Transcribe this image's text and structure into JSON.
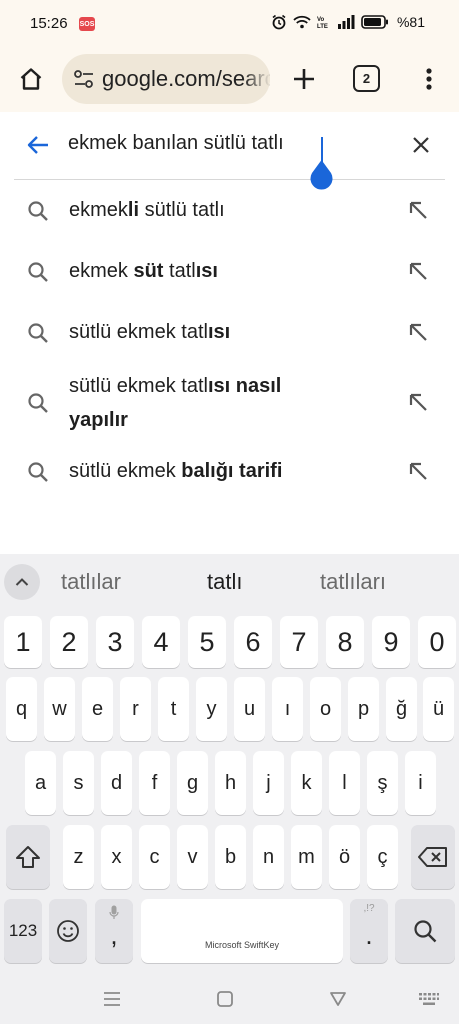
{
  "status_bar": {
    "time": "15:26",
    "sos": "SOS",
    "battery": "%81"
  },
  "browser": {
    "url": "google.com/search",
    "tab_count": "2"
  },
  "search": {
    "query": "ekmek banılan sütlü tatlı"
  },
  "suggestions": [
    {
      "parts": [
        {
          "t": "ekmek",
          "b": false
        },
        {
          "t": "li",
          "b": true
        },
        {
          "t": " sütlü tatlı",
          "b": false
        }
      ]
    },
    {
      "parts": [
        {
          "t": "ekmek ",
          "b": false
        },
        {
          "t": "süt",
          "b": true
        },
        {
          "t": " tatl",
          "b": false
        },
        {
          "t": "ısı",
          "b": true
        }
      ]
    },
    {
      "parts": [
        {
          "t": "sütlü ekmek tatl",
          "b": false
        },
        {
          "t": "ısı",
          "b": true
        }
      ]
    },
    {
      "parts": [
        {
          "t": "sütlü ekmek tatl",
          "b": false
        },
        {
          "t": "ısı nasıl yapılır",
          "b": true
        }
      ]
    },
    {
      "parts": [
        {
          "t": "sütlü ekmek ",
          "b": false
        },
        {
          "t": "balığı tarifi",
          "b": true
        }
      ]
    }
  ],
  "keyboard": {
    "predictions": [
      "tatlılar",
      "tatlı",
      "tatlıları"
    ],
    "number_row": [
      "1",
      "2",
      "3",
      "4",
      "5",
      "6",
      "7",
      "8",
      "9",
      "0"
    ],
    "row1": [
      "q",
      "w",
      "e",
      "r",
      "t",
      "y",
      "u",
      "ı",
      "o",
      "p",
      "ğ",
      "ü"
    ],
    "row2": [
      "a",
      "s",
      "d",
      "f",
      "g",
      "h",
      "j",
      "k",
      "l",
      "ş",
      "i"
    ],
    "row3": [
      "z",
      "x",
      "c",
      "v",
      "b",
      "n",
      "m",
      "ö",
      "ç"
    ],
    "symbols_key": "123",
    "comma_key": ",",
    "period_key": ".",
    "period_hint": ",!?",
    "space_label": "Microsoft SwiftKey"
  },
  "colors": {
    "accent": "#1a66d9",
    "toolbar_bg": "#fdf8f0",
    "url_bar_bg": "#efe7d8",
    "keyboard_bg": "#f0f0f2"
  }
}
